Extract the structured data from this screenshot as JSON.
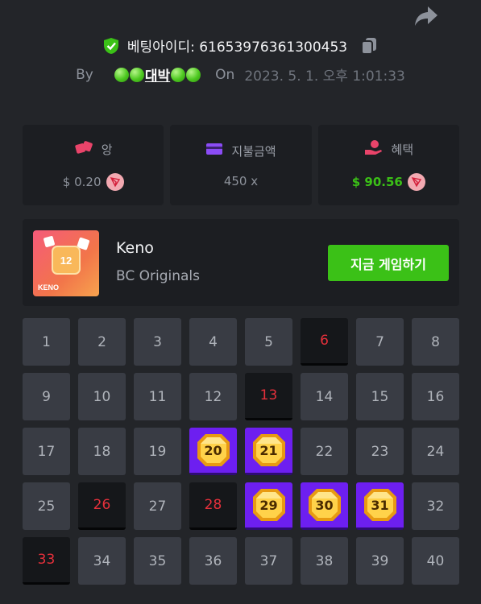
{
  "header": {
    "bet_id_label": "베팅아이디: 61653976361300453",
    "by_label": "By",
    "username_text": "대박",
    "on_label": "On",
    "date": "2023. 5. 1. 오후 1:01:33"
  },
  "stats": [
    {
      "label": "앙",
      "value": "$ 0.20",
      "icon": "dice-icon",
      "color": "#e9446a"
    },
    {
      "label": "지불금액",
      "value": "450 x",
      "icon": "card-icon",
      "color": "#8b4cf6"
    },
    {
      "label": "혜택",
      "value": "$ 90.56",
      "icon": "hand-coin-icon",
      "color": "#e9446a"
    }
  ],
  "game": {
    "title": "Keno",
    "provider": "BC Originals",
    "thumb_text": "KENO",
    "thumb_number": "12",
    "play_label": "지금 게임하기"
  },
  "grid": [
    {
      "n": "1",
      "state": "normal"
    },
    {
      "n": "2",
      "state": "normal"
    },
    {
      "n": "3",
      "state": "normal"
    },
    {
      "n": "4",
      "state": "normal"
    },
    {
      "n": "5",
      "state": "normal"
    },
    {
      "n": "6",
      "state": "miss"
    },
    {
      "n": "7",
      "state": "normal"
    },
    {
      "n": "8",
      "state": "normal"
    },
    {
      "n": "9",
      "state": "normal"
    },
    {
      "n": "10",
      "state": "normal"
    },
    {
      "n": "11",
      "state": "normal"
    },
    {
      "n": "12",
      "state": "normal"
    },
    {
      "n": "13",
      "state": "miss"
    },
    {
      "n": "14",
      "state": "normal"
    },
    {
      "n": "15",
      "state": "normal"
    },
    {
      "n": "16",
      "state": "normal"
    },
    {
      "n": "17",
      "state": "normal"
    },
    {
      "n": "18",
      "state": "normal"
    },
    {
      "n": "19",
      "state": "normal"
    },
    {
      "n": "20",
      "state": "hit"
    },
    {
      "n": "21",
      "state": "hit"
    },
    {
      "n": "22",
      "state": "normal"
    },
    {
      "n": "23",
      "state": "normal"
    },
    {
      "n": "24",
      "state": "normal"
    },
    {
      "n": "25",
      "state": "normal"
    },
    {
      "n": "26",
      "state": "miss"
    },
    {
      "n": "27",
      "state": "normal"
    },
    {
      "n": "28",
      "state": "miss"
    },
    {
      "n": "29",
      "state": "hit"
    },
    {
      "n": "30",
      "state": "hit"
    },
    {
      "n": "31",
      "state": "hit"
    },
    {
      "n": "32",
      "state": "normal"
    },
    {
      "n": "33",
      "state": "miss"
    },
    {
      "n": "34",
      "state": "normal"
    },
    {
      "n": "35",
      "state": "normal"
    },
    {
      "n": "36",
      "state": "normal"
    },
    {
      "n": "37",
      "state": "normal"
    },
    {
      "n": "38",
      "state": "normal"
    },
    {
      "n": "39",
      "state": "normal"
    },
    {
      "n": "40",
      "state": "normal"
    }
  ]
}
